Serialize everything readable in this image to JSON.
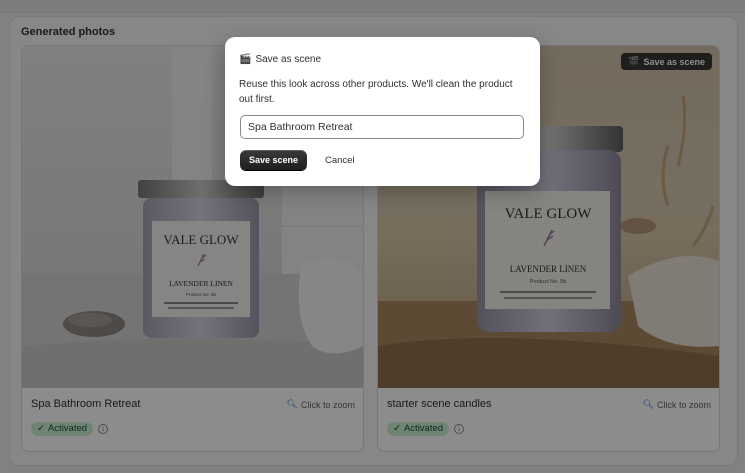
{
  "section": {
    "title": "Generated photos"
  },
  "cards": [
    {
      "caption": "Spa Bathroom Retreat",
      "zoom_label": "Click to zoom",
      "zoom_icon": "magnifier-icon",
      "badge": "Activated",
      "badge_icon": "check-icon",
      "info_icon": "info-icon",
      "label_brand": "VALE GLOW",
      "label_scent": "LAVENDER LINEN",
      "label_product": "Product No. 5b"
    },
    {
      "caption": "starter scene candles",
      "zoom_label": "Click to zoom",
      "zoom_icon": "magnifier-icon",
      "badge": "Activated",
      "badge_icon": "check-icon",
      "info_icon": "info-icon",
      "save_scene": "Save as scene",
      "save_scene_icon": "clapperboard-icon",
      "label_brand": "VALE GLOW",
      "label_scent": "LAVENDER LINEN",
      "label_product": "Product No. 5b"
    }
  ],
  "modal": {
    "title": "Save as scene",
    "title_icon": "clapperboard-icon",
    "description": "Reuse this look across other products. We'll clean the product out first.",
    "input_value": "Spa Bathroom Retreat",
    "save_label": "Save scene",
    "cancel_label": "Cancel"
  }
}
